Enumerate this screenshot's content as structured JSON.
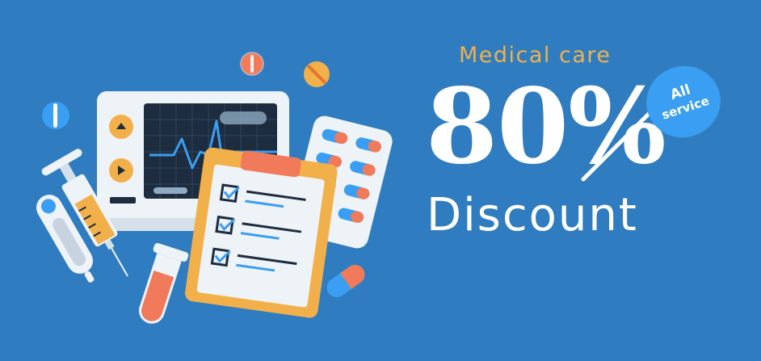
{
  "banner": {
    "tagline": "Medical care",
    "percent": "80%",
    "badge_line1": "All",
    "badge_line2": "service",
    "headline": "Discount"
  },
  "icons": [
    "heart-monitor-icon",
    "pill-icon",
    "syringe-icon",
    "thermometer-icon",
    "test-tube-icon",
    "clipboard-checklist-icon",
    "pill-blister-pack-icon",
    "capsule-icon"
  ],
  "colors": {
    "background": "#2f7dc0",
    "accent_orange": "#f2b04a",
    "badge_blue": "#3a9ef2",
    "text_white": "#ffffff"
  }
}
